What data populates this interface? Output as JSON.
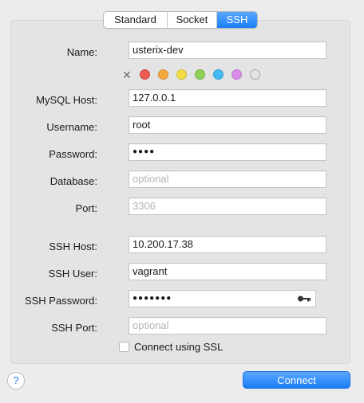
{
  "tabs": [
    {
      "label": "Standard",
      "active": false
    },
    {
      "label": "Socket",
      "active": false
    },
    {
      "label": "SSH",
      "active": true
    }
  ],
  "form": {
    "name_label": "Name:",
    "name_value": "usterix-dev",
    "mysql_host_label": "MySQL Host:",
    "mysql_host_value": "127.0.0.1",
    "username_label": "Username:",
    "username_value": "root",
    "password_label": "Password:",
    "password_value": "●●●●",
    "database_label": "Database:",
    "database_placeholder": "optional",
    "port_label": "Port:",
    "port_placeholder": "3306",
    "ssh_host_label": "SSH Host:",
    "ssh_host_value": "10.200.17.38",
    "ssh_user_label": "SSH User:",
    "ssh_user_value": "vagrant",
    "ssh_password_label": "SSH Password:",
    "ssh_password_value": "●●●●●●●",
    "ssh_port_label": "SSH Port:",
    "ssh_port_placeholder": "optional",
    "ssl_label": "Connect using SSL",
    "ssl_checked": false
  },
  "color_tags": [
    "#ee5a52",
    "#f5a83b",
    "#f2dc46",
    "#8fd056",
    "#45b9f4",
    "#d98de8",
    "#d0d0d0"
  ],
  "buttons": {
    "help_label": "?",
    "connect_label": "Connect"
  }
}
